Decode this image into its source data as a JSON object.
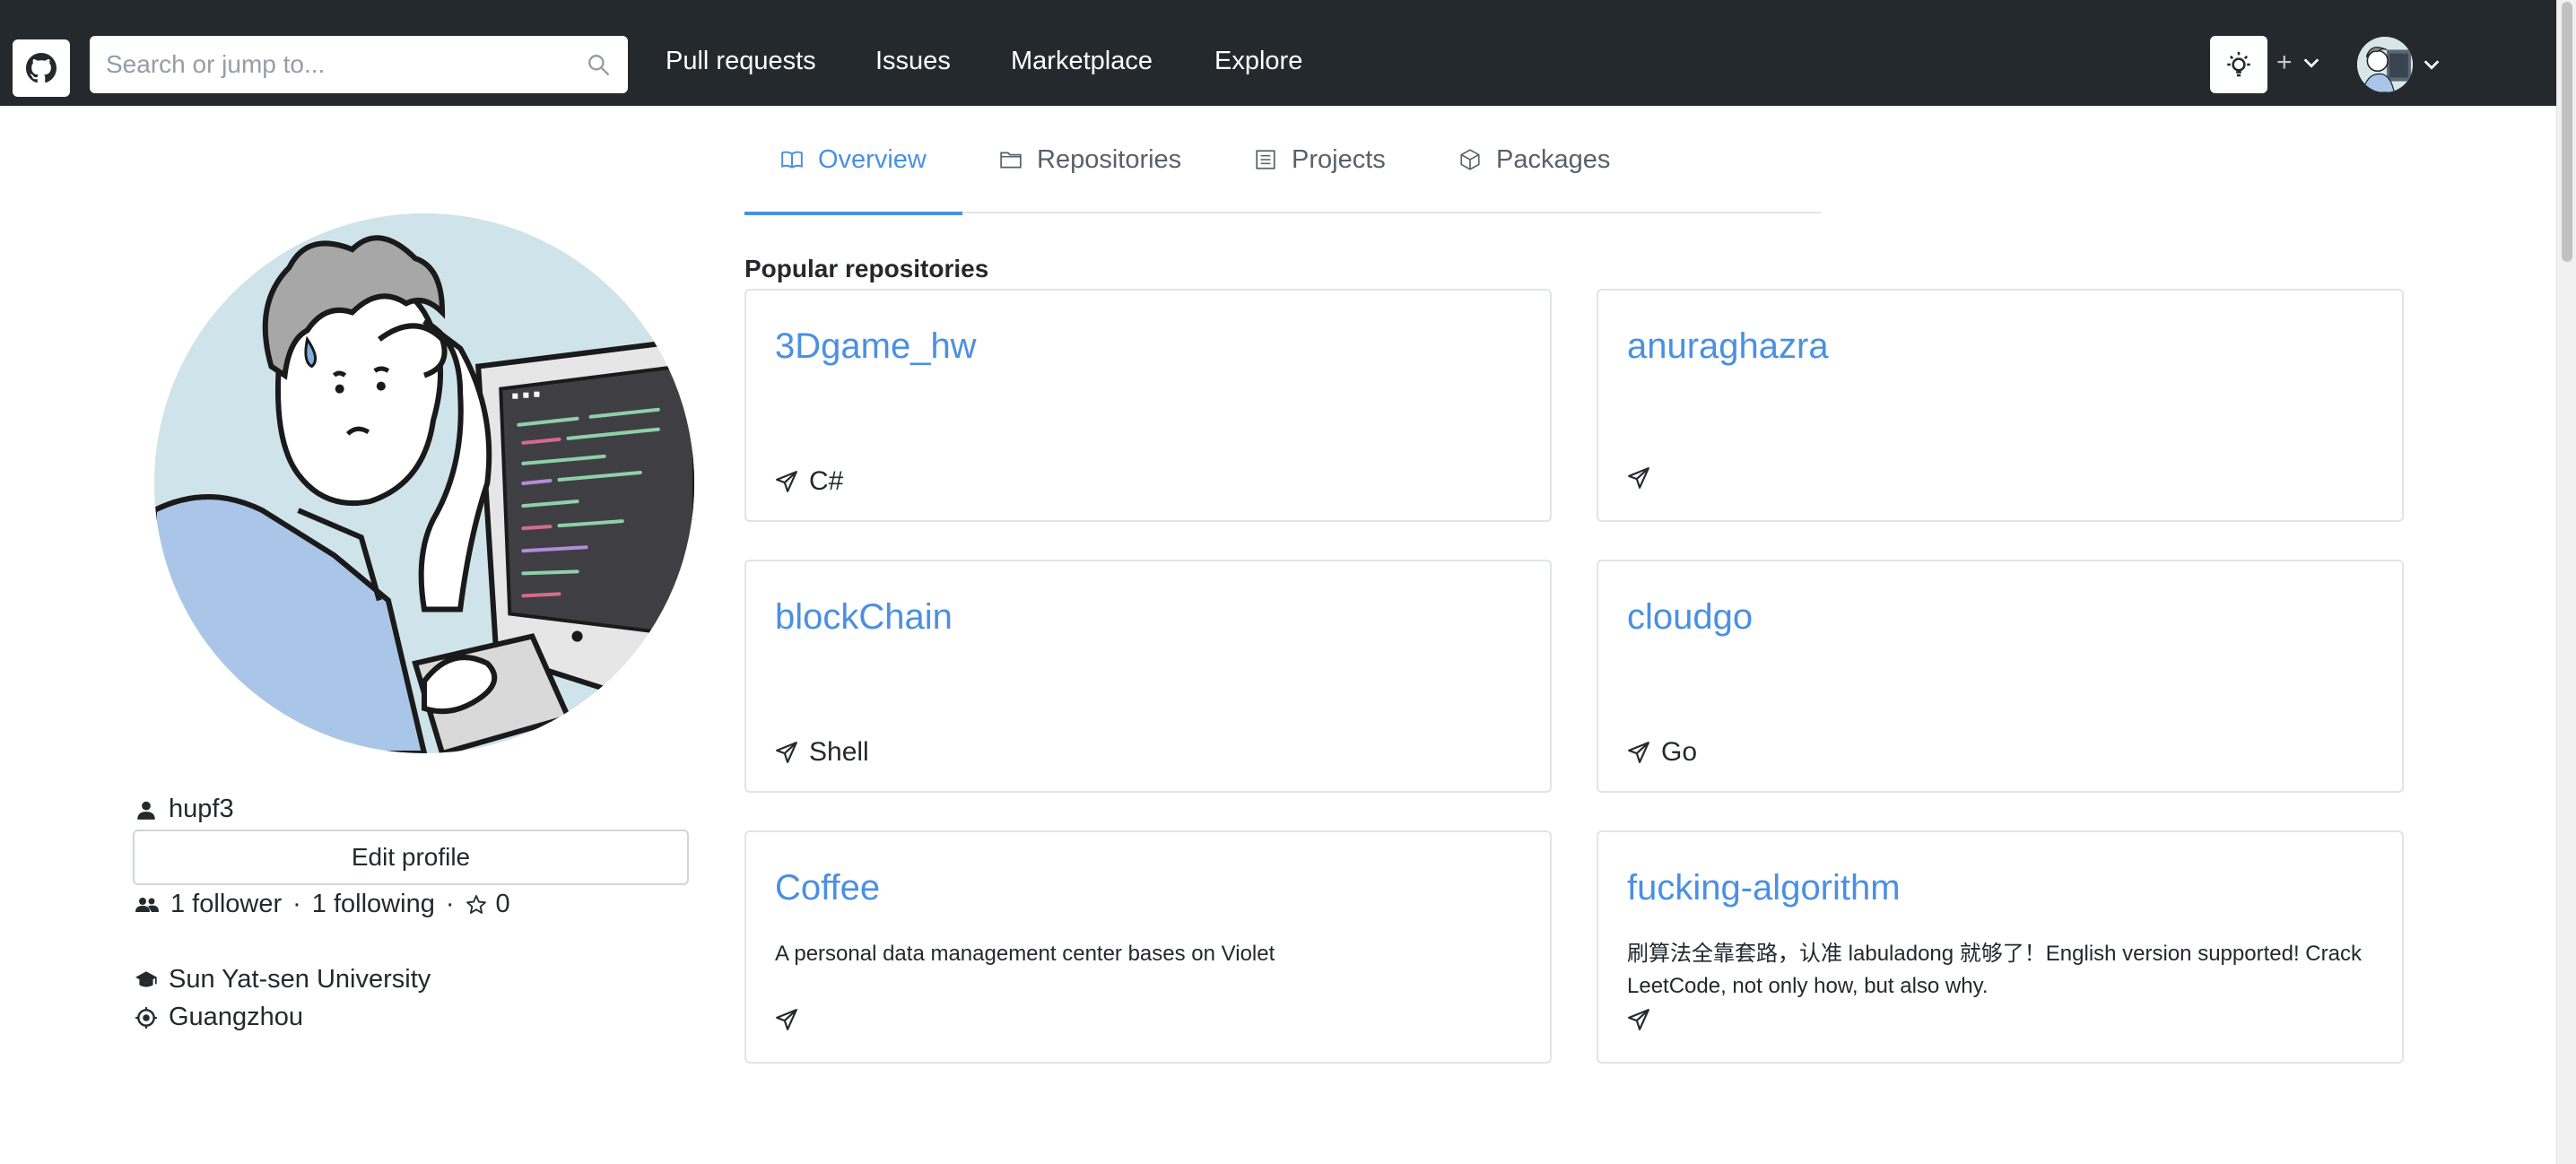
{
  "header": {
    "search_placeholder": "Search or jump to...",
    "nav": {
      "pull_requests": "Pull requests",
      "issues": "Issues",
      "marketplace": "Marketplace",
      "explore": "Explore"
    },
    "plus_label": "+"
  },
  "tabs": {
    "overview": "Overview",
    "repositories": "Repositories",
    "projects": "Projects",
    "packages": "Packages"
  },
  "profile": {
    "username": "hupf3",
    "edit_label": "Edit profile",
    "followers_text": "1 follower",
    "following_text": "1 following",
    "separator": "·",
    "stars_count": "0",
    "organization": "Sun Yat-sen University",
    "location": "Guangzhou"
  },
  "popular": {
    "title": "Popular repositories",
    "repos": [
      {
        "name": "3Dgame_hw",
        "description": "",
        "language": "C#"
      },
      {
        "name": "anuraghazra",
        "description": "",
        "language": ""
      },
      {
        "name": "blockChain",
        "description": "",
        "language": "Shell"
      },
      {
        "name": "cloudgo",
        "description": "",
        "language": "Go"
      },
      {
        "name": "Coffee",
        "description": "A personal data management center bases on Violet",
        "language": ""
      },
      {
        "name": "fucking-algorithm",
        "description": "刷算法全靠套路，认准 labuladong 就够了！English version supported! Crack LeetCode, not only how, but also why.",
        "language": ""
      }
    ]
  },
  "colors": {
    "header_bg": "#24292e",
    "link_blue": "#4a90e2",
    "border": "#e1e4e8"
  },
  "icons": [
    "github-logo-icon",
    "search-icon",
    "lightbulb-icon",
    "chevron-down-icon",
    "book-icon",
    "repo-icon",
    "project-icon",
    "package-icon",
    "person-icon",
    "people-icon",
    "star-icon",
    "org-icon",
    "location-icon",
    "send-icon"
  ]
}
